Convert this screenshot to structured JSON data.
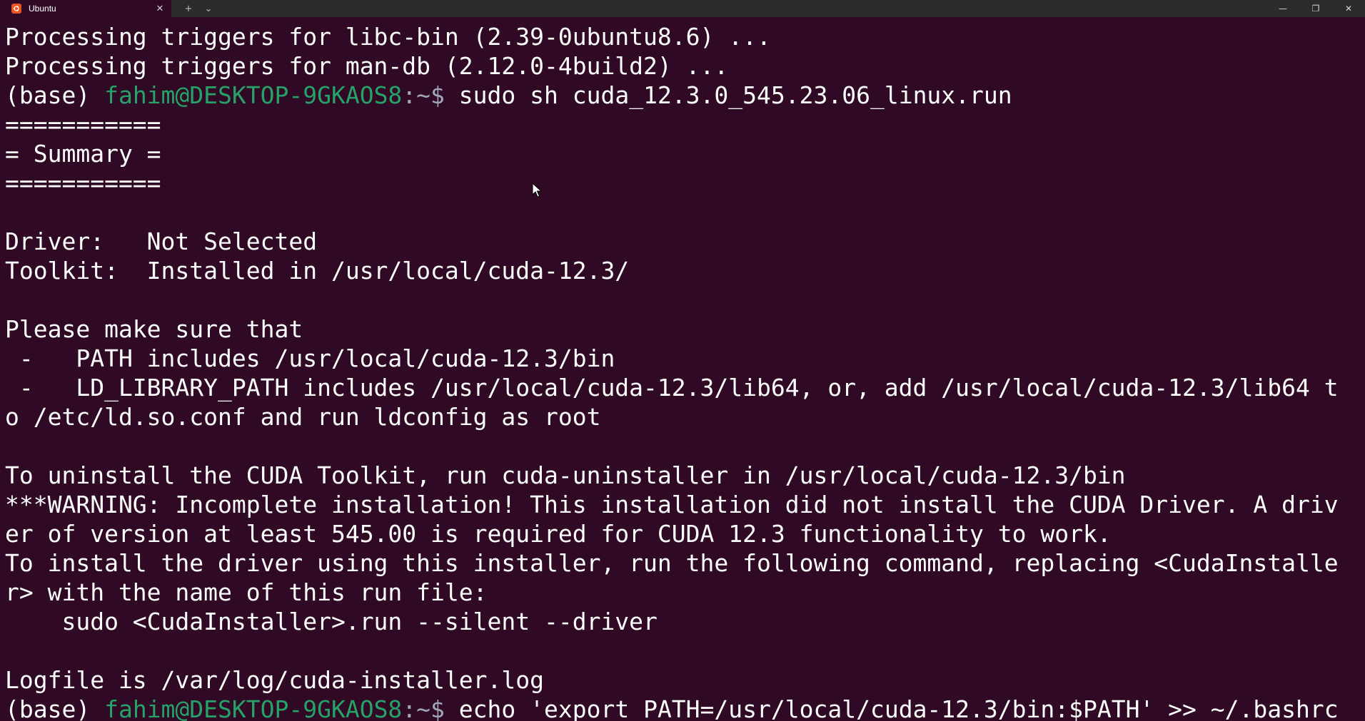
{
  "window": {
    "tab_title": "Ubuntu",
    "tab_close_glyph": "✕",
    "new_tab_glyph": "+",
    "dropdown_glyph": "⌄",
    "minimize_glyph": "—",
    "maximize_glyph": "❐",
    "close_glyph": "✕",
    "tab_icon": "ubuntu-logo-icon",
    "colors": {
      "background": "#300a24",
      "titlebar": "#2b2b2b",
      "user_host": "#26a269",
      "text": "#ffffff",
      "ubuntu_orange": "#e95420"
    }
  },
  "terminal": {
    "lines": [
      "Processing triggers for libc-bin (2.39-0ubuntu8.6) ...",
      "Processing triggers for man-db (2.12.0-4build2) ...",
      "",
      "===========",
      "= Summary =",
      "===========",
      "",
      "Driver:   Not Selected",
      "Toolkit:  Installed in /usr/local/cuda-12.3/",
      "",
      "Please make sure that",
      " -   PATH includes /usr/local/cuda-12.3/bin",
      " -   LD_LIBRARY_PATH includes /usr/local/cuda-12.3/lib64, or, add /usr/local/cuda-12.3/lib64 t",
      "o /etc/ld.so.conf and run ldconfig as root",
      "",
      "To uninstall the CUDA Toolkit, run cuda-uninstaller in /usr/local/cuda-12.3/bin",
      "***WARNING: Incomplete installation! This installation did not install the CUDA Driver. A driv",
      "er of version at least 545.00 is required for CUDA 12.3 functionality to work.",
      "To install the driver using this installer, run the following command, replacing <CudaInstalle",
      "r> with the name of this run file:",
      "    sudo <CudaInstaller>.run --silent --driver",
      "",
      "Logfile is /var/log/cuda-installer.log"
    ],
    "prompt1": {
      "env": "(base) ",
      "user_host": "fahim@DESKTOP-9GKAOS8",
      "path": ":~$ ",
      "command": "sudo sh cuda_12.3.0_545.23.06_linux.run"
    },
    "prompt2": {
      "env": "(base) ",
      "user_host": "fahim@DESKTOP-9GKAOS8",
      "path": ":~$ ",
      "command": "echo 'export PATH=/usr/local/cuda-12.3/bin:$PATH' >> ~/.bashrc"
    }
  }
}
